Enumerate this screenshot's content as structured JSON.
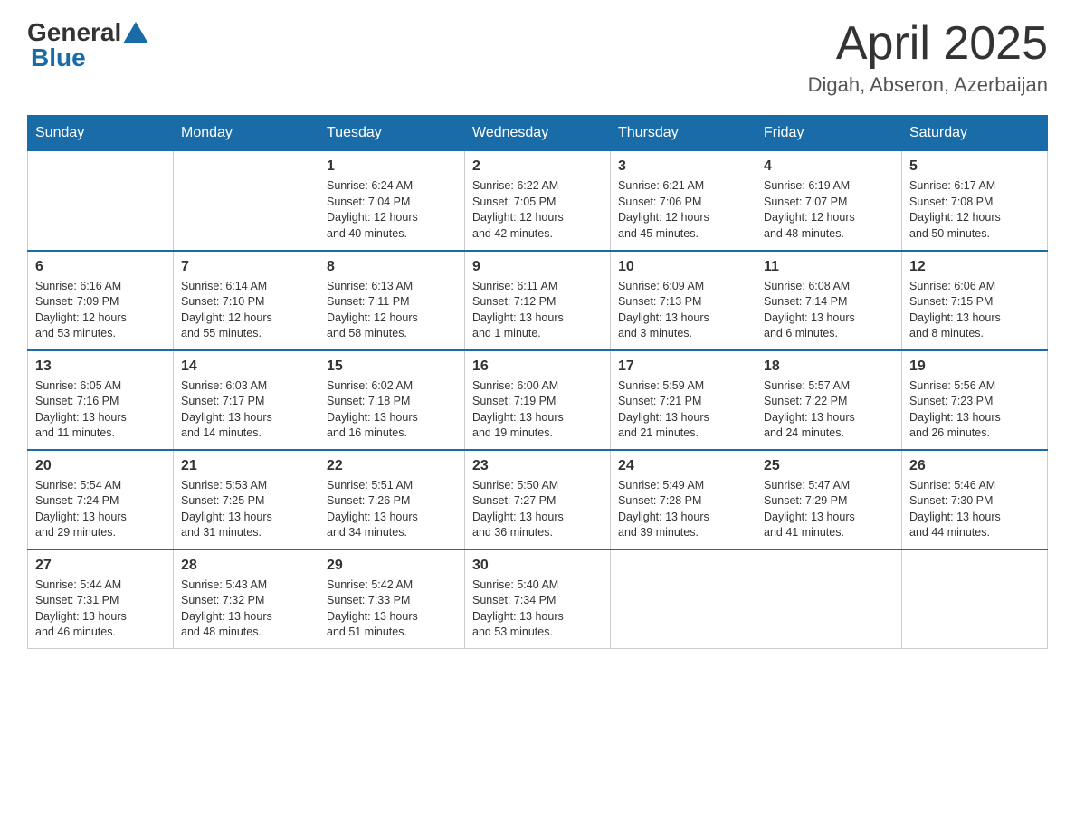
{
  "header": {
    "logo": {
      "text1": "General",
      "text2": "Blue"
    },
    "title": "April 2025",
    "location": "Digah, Abseron, Azerbaijan"
  },
  "weekdays": [
    "Sunday",
    "Monday",
    "Tuesday",
    "Wednesday",
    "Thursday",
    "Friday",
    "Saturday"
  ],
  "weeks": [
    [
      {
        "day": "",
        "info": ""
      },
      {
        "day": "",
        "info": ""
      },
      {
        "day": "1",
        "info": "Sunrise: 6:24 AM\nSunset: 7:04 PM\nDaylight: 12 hours\nand 40 minutes."
      },
      {
        "day": "2",
        "info": "Sunrise: 6:22 AM\nSunset: 7:05 PM\nDaylight: 12 hours\nand 42 minutes."
      },
      {
        "day": "3",
        "info": "Sunrise: 6:21 AM\nSunset: 7:06 PM\nDaylight: 12 hours\nand 45 minutes."
      },
      {
        "day": "4",
        "info": "Sunrise: 6:19 AM\nSunset: 7:07 PM\nDaylight: 12 hours\nand 48 minutes."
      },
      {
        "day": "5",
        "info": "Sunrise: 6:17 AM\nSunset: 7:08 PM\nDaylight: 12 hours\nand 50 minutes."
      }
    ],
    [
      {
        "day": "6",
        "info": "Sunrise: 6:16 AM\nSunset: 7:09 PM\nDaylight: 12 hours\nand 53 minutes."
      },
      {
        "day": "7",
        "info": "Sunrise: 6:14 AM\nSunset: 7:10 PM\nDaylight: 12 hours\nand 55 minutes."
      },
      {
        "day": "8",
        "info": "Sunrise: 6:13 AM\nSunset: 7:11 PM\nDaylight: 12 hours\nand 58 minutes."
      },
      {
        "day": "9",
        "info": "Sunrise: 6:11 AM\nSunset: 7:12 PM\nDaylight: 13 hours\nand 1 minute."
      },
      {
        "day": "10",
        "info": "Sunrise: 6:09 AM\nSunset: 7:13 PM\nDaylight: 13 hours\nand 3 minutes."
      },
      {
        "day": "11",
        "info": "Sunrise: 6:08 AM\nSunset: 7:14 PM\nDaylight: 13 hours\nand 6 minutes."
      },
      {
        "day": "12",
        "info": "Sunrise: 6:06 AM\nSunset: 7:15 PM\nDaylight: 13 hours\nand 8 minutes."
      }
    ],
    [
      {
        "day": "13",
        "info": "Sunrise: 6:05 AM\nSunset: 7:16 PM\nDaylight: 13 hours\nand 11 minutes."
      },
      {
        "day": "14",
        "info": "Sunrise: 6:03 AM\nSunset: 7:17 PM\nDaylight: 13 hours\nand 14 minutes."
      },
      {
        "day": "15",
        "info": "Sunrise: 6:02 AM\nSunset: 7:18 PM\nDaylight: 13 hours\nand 16 minutes."
      },
      {
        "day": "16",
        "info": "Sunrise: 6:00 AM\nSunset: 7:19 PM\nDaylight: 13 hours\nand 19 minutes."
      },
      {
        "day": "17",
        "info": "Sunrise: 5:59 AM\nSunset: 7:21 PM\nDaylight: 13 hours\nand 21 minutes."
      },
      {
        "day": "18",
        "info": "Sunrise: 5:57 AM\nSunset: 7:22 PM\nDaylight: 13 hours\nand 24 minutes."
      },
      {
        "day": "19",
        "info": "Sunrise: 5:56 AM\nSunset: 7:23 PM\nDaylight: 13 hours\nand 26 minutes."
      }
    ],
    [
      {
        "day": "20",
        "info": "Sunrise: 5:54 AM\nSunset: 7:24 PM\nDaylight: 13 hours\nand 29 minutes."
      },
      {
        "day": "21",
        "info": "Sunrise: 5:53 AM\nSunset: 7:25 PM\nDaylight: 13 hours\nand 31 minutes."
      },
      {
        "day": "22",
        "info": "Sunrise: 5:51 AM\nSunset: 7:26 PM\nDaylight: 13 hours\nand 34 minutes."
      },
      {
        "day": "23",
        "info": "Sunrise: 5:50 AM\nSunset: 7:27 PM\nDaylight: 13 hours\nand 36 minutes."
      },
      {
        "day": "24",
        "info": "Sunrise: 5:49 AM\nSunset: 7:28 PM\nDaylight: 13 hours\nand 39 minutes."
      },
      {
        "day": "25",
        "info": "Sunrise: 5:47 AM\nSunset: 7:29 PM\nDaylight: 13 hours\nand 41 minutes."
      },
      {
        "day": "26",
        "info": "Sunrise: 5:46 AM\nSunset: 7:30 PM\nDaylight: 13 hours\nand 44 minutes."
      }
    ],
    [
      {
        "day": "27",
        "info": "Sunrise: 5:44 AM\nSunset: 7:31 PM\nDaylight: 13 hours\nand 46 minutes."
      },
      {
        "day": "28",
        "info": "Sunrise: 5:43 AM\nSunset: 7:32 PM\nDaylight: 13 hours\nand 48 minutes."
      },
      {
        "day": "29",
        "info": "Sunrise: 5:42 AM\nSunset: 7:33 PM\nDaylight: 13 hours\nand 51 minutes."
      },
      {
        "day": "30",
        "info": "Sunrise: 5:40 AM\nSunset: 7:34 PM\nDaylight: 13 hours\nand 53 minutes."
      },
      {
        "day": "",
        "info": ""
      },
      {
        "day": "",
        "info": ""
      },
      {
        "day": "",
        "info": ""
      }
    ]
  ]
}
